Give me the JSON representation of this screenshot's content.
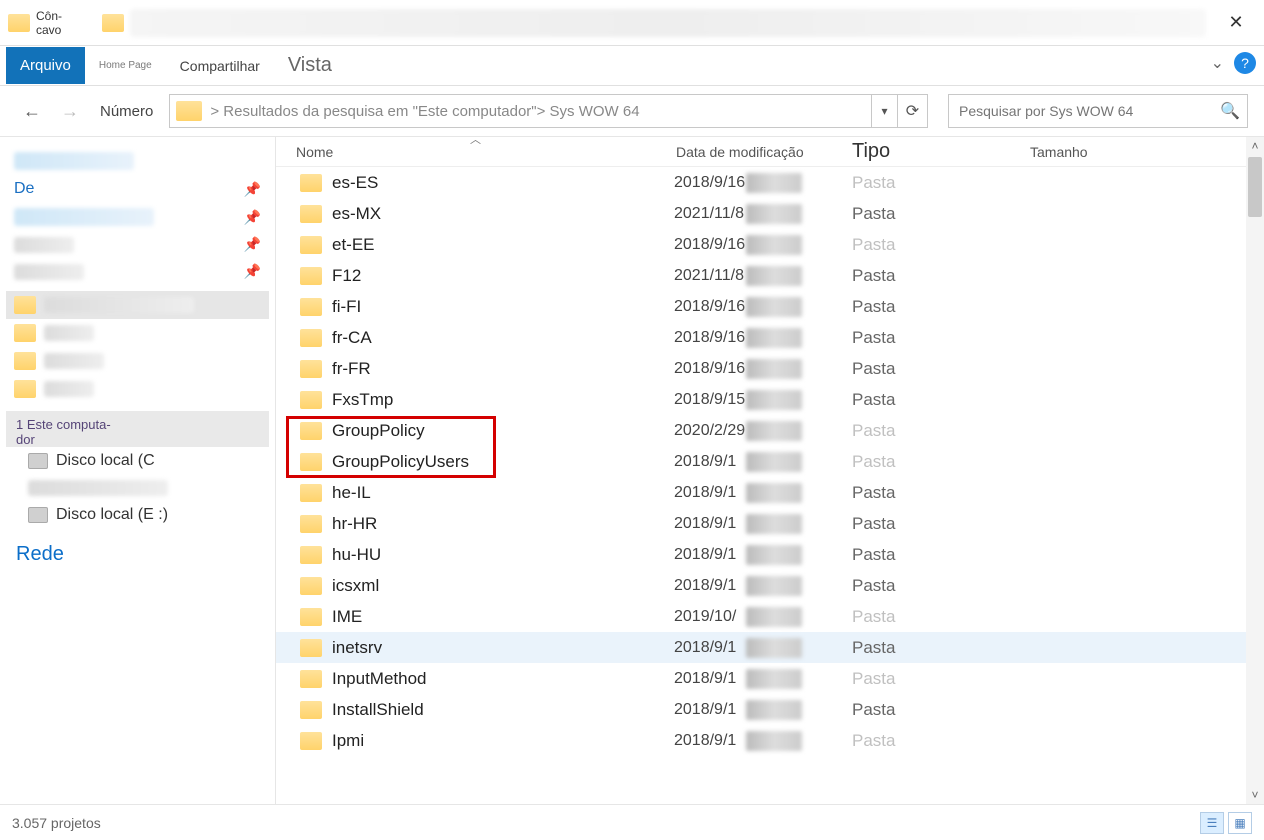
{
  "titlebar": {
    "title": "Côn-\ncavo"
  },
  "ribbon": {
    "arquivo": "Arquivo",
    "home": "Home Page",
    "compartilhar": "Compartilhar",
    "vista": "Vista",
    "help": "?"
  },
  "nav": {
    "numero": "Número",
    "path": "> Resultados da pesquisa em \"Este computador\"> Sys WOW 64",
    "search_placeholder": "Pesquisar por Sys WOW 64"
  },
  "sidebar": {
    "de": "De",
    "este_comp": "1 Este computa-\ndor",
    "disco_c": "Disco local (C",
    "disco_e": "Disco local (E :)",
    "rede": "Rede"
  },
  "columns": {
    "nome": "Nome",
    "data": "Data de modificação",
    "tipo": "Tipo",
    "tamanho": "Tamanho"
  },
  "rows": [
    {
      "name": "es-ES",
      "date": "2018/9/16",
      "type": "Pasta",
      "pale": true
    },
    {
      "name": "es-MX",
      "date": "2021/11/8",
      "type": "Pasta"
    },
    {
      "name": "et-EE",
      "date": "2018/9/16",
      "type": "Pasta",
      "pale": true
    },
    {
      "name": "F12",
      "date": "2021/11/8",
      "type": "Pasta"
    },
    {
      "name": "fi-FI",
      "date": "2018/9/16",
      "type": "Pasta"
    },
    {
      "name": "fr-CA",
      "date": "2018/9/16",
      "type": "Pasta"
    },
    {
      "name": "fr-FR",
      "date": "2018/9/16",
      "type": "Pasta"
    },
    {
      "name": "FxsTmp",
      "date": "2018/9/15",
      "type": "Pasta"
    },
    {
      "name": "GroupPolicy",
      "date": "2020/2/29",
      "type": "Pasta",
      "pale": true
    },
    {
      "name": "GroupPolicyUsers",
      "date": "2018/9/1",
      "type": "Pasta",
      "pale": true
    },
    {
      "name": "he-IL",
      "date": "2018/9/1",
      "type": "Pasta"
    },
    {
      "name": "hr-HR",
      "date": "2018/9/1",
      "type": "Pasta"
    },
    {
      "name": "hu-HU",
      "date": "2018/9/1",
      "type": "Pasta"
    },
    {
      "name": "icsxml",
      "date": "2018/9/1",
      "type": "Pasta"
    },
    {
      "name": "IME",
      "date": "2019/10/",
      "type": "Pasta",
      "pale": true
    },
    {
      "name": "inetsrv",
      "date": "2018/9/1",
      "type": "Pasta",
      "sel": true,
      "tpale": true
    },
    {
      "name": "InputMethod",
      "date": "2018/9/1",
      "type": "Pasta",
      "pale": true
    },
    {
      "name": "InstallShield",
      "date": "2018/9/1",
      "type": "Pasta"
    },
    {
      "name": "Ipmi",
      "date": "2018/9/1",
      "type": "Pasta",
      "pale": true
    }
  ],
  "status": {
    "count": "3.057 projetos"
  }
}
